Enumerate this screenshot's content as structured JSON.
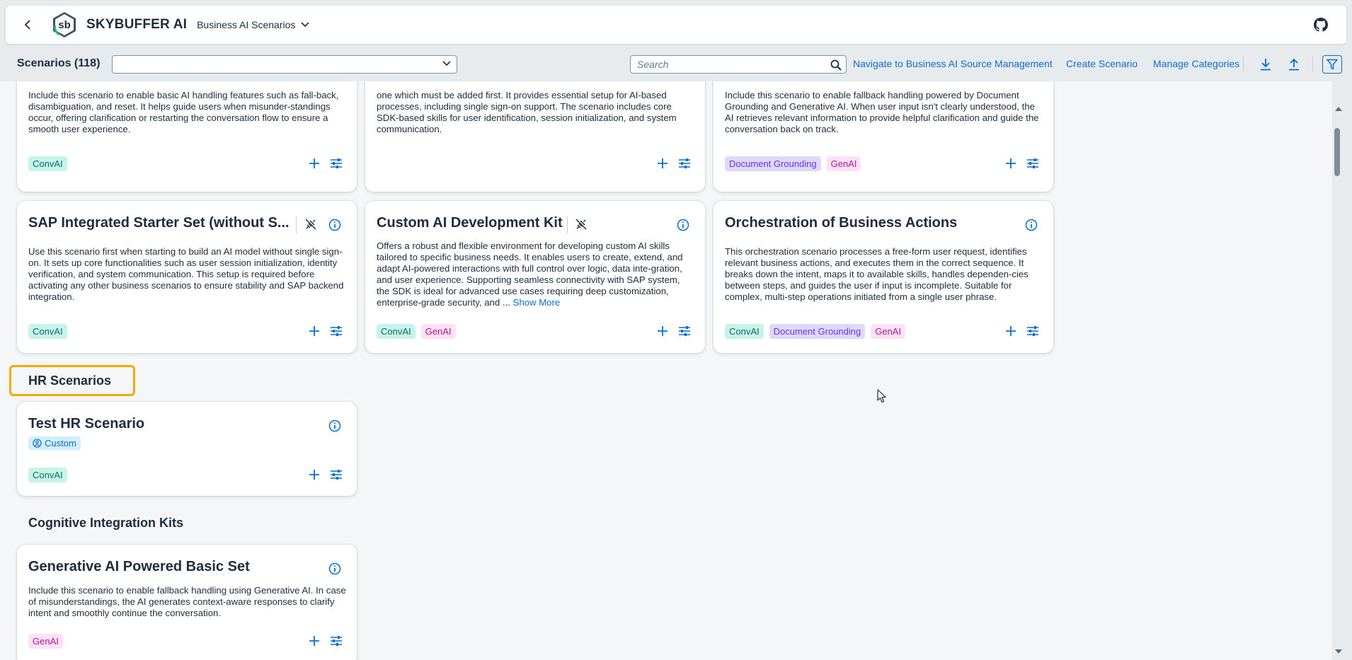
{
  "shell": {
    "brand": "SKYBUFFER AI",
    "app_menu": "Business AI Scenarios",
    "logo_text": "sb"
  },
  "toolbar": {
    "title": "Scenarios (118)",
    "select_value": "",
    "search_placeholder": "Search",
    "links": {
      "navigate": "Navigate to Business AI Source Management",
      "create": "Create Scenario",
      "manage": "Manage Categories"
    }
  },
  "cards_top": [
    {
      "desc": "Include this scenario to enable basic AI handling features such as fall-back, disambiguation, and reset. It helps guide users when misunder-standings occur, offering clarification or restarting the conversation flow to ensure a smooth user experience.",
      "tags": [
        "ConvAI"
      ]
    },
    {
      "desc": "one which must be added first. It provides essential setup for AI-based processes, including single sign-on support. The scenario includes core SDK-based skills for user identification, session initialization, and system communication.",
      "tags": []
    },
    {
      "desc": "Include this scenario to enable fallback handling powered by Document Grounding and Generative AI. When user input isn't clearly understood, the AI retrieves relevant information to provide helpful clarification and guide the conversation back on track.",
      "tags": [
        "Document Grounding",
        "GenAI"
      ]
    }
  ],
  "cards_mid": [
    {
      "title": "SAP Integrated Starter Set (without S...",
      "desc": "Use this scenario first when starting to build an AI model without single sign-on. It sets up core functionalities such as user session initialization, identity verification, and system communication. This setup is required before activating any other business scenarios to ensure stability and SAP backend integration.",
      "tags": [
        "ConvAI"
      ]
    },
    {
      "title": "Custom AI Development Kit",
      "desc": "Offers a robust and flexible environment for developing custom AI skills tailored to specific business needs. It enables users to create, extend, and adapt AI-powered interactions with full control over logic, data inte-gration, and user experience. Supporting seamless connectivity with SAP system, the SDK is ideal for advanced use cases requiring deep customization, enterprise-grade security, and ...",
      "show_more": "Show More",
      "tags": [
        "ConvAI",
        "GenAI"
      ]
    },
    {
      "title": "Orchestration of Business Actions",
      "desc": "This orchestration scenario processes a free-form user request, identifies relevant business actions, and executes them in the correct sequence. It breaks down the intent, maps it to available skills, handles dependen-cies between steps, and guides the user if input is incomplete. Suitable for complex, multi-step operations initiated from a single user phrase.",
      "tags": [
        "ConvAI",
        "Document Grounding",
        "GenAI"
      ]
    }
  ],
  "sections": {
    "hr": "HR Scenarios",
    "cognitive": "Cognitive Integration Kits"
  },
  "hr_card": {
    "title": "Test HR Scenario",
    "badge": "Custom",
    "tags": [
      "ConvAI"
    ]
  },
  "cog_card": {
    "title": "Generative AI Powered Basic Set",
    "desc": "Include this scenario to enable fallback handling using Generative AI. In case of misunderstandings, the AI generates context-aware responses to clarify intent and smoothly continue the conversation.",
    "tags": [
      "GenAI"
    ]
  },
  "colors": {
    "accent": "#0a6ed1",
    "highlight": "#f0ab00",
    "tag_convai": "#c6f4ea",
    "tag_genai": "#fde2f6",
    "tag_doc": "#e0d7fb"
  },
  "icons": {
    "back": "chevron-left-icon",
    "app_menu": "chevron-down-icon",
    "github": "github-icon",
    "search": "search-icon",
    "download": "download-icon",
    "upload": "upload-icon",
    "filter": "filter-icon",
    "add": "plus-icon",
    "configure": "sliders-icon",
    "info": "info-icon",
    "disconnected": "disconnected-icon",
    "custom": "user-icon"
  }
}
